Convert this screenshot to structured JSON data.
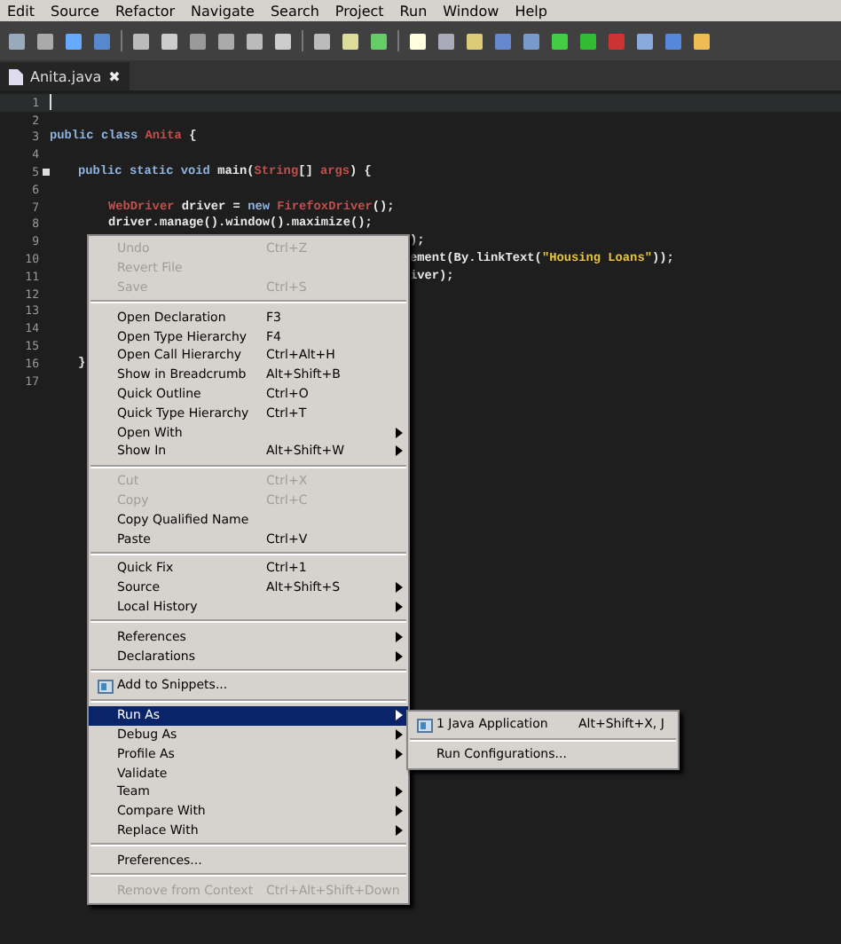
{
  "menubar": [
    "Edit",
    "Source",
    "Refactor",
    "Navigate",
    "Search",
    "Project",
    "Run",
    "Window",
    "Help"
  ],
  "tab": {
    "label": "Anita.java",
    "close": "✖",
    "selected": true
  },
  "editor": {
    "lines": [
      {
        "number": "1",
        "kind": "blank",
        "current": true
      },
      {
        "number": "2",
        "kind": "blank"
      },
      {
        "number": "3",
        "kind": "class",
        "tokens": [
          {
            "kind": "keyword",
            "text": "public class "
          },
          {
            "kind": "type",
            "text": "Anita"
          },
          {
            "kind": "plain",
            "text": " {"
          }
        ]
      },
      {
        "number": "4",
        "kind": "blank"
      },
      {
        "number": "5",
        "fold": true,
        "kind": "method",
        "tokens": [
          {
            "kind": "keyword",
            "text": "public static void "
          },
          {
            "kind": "plain",
            "text": "main("
          },
          {
            "kind": "type",
            "text": "String"
          },
          {
            "kind": "plain",
            "text": "[] "
          },
          {
            "kind": "type",
            "text": "args"
          },
          {
            "kind": "plain",
            "text": ") {"
          }
        ]
      },
      {
        "number": "6",
        "kind": "blank"
      },
      {
        "number": "7",
        "kind": "statement",
        "tokens": [
          {
            "kind": "type",
            "text": "WebDriver"
          },
          {
            "kind": "plain",
            "text": " driver = "
          },
          {
            "kind": "keyword",
            "text": "new "
          },
          {
            "kind": "type",
            "text": "FirefoxDriver"
          },
          {
            "kind": "plain",
            "text": "();"
          }
        ]
      },
      {
        "number": "8",
        "kind": "statement",
        "tokens": [
          {
            "kind": "plain",
            "text": "driver.manage().window().maximize();"
          }
        ]
      },
      {
        "number": "9",
        "kind": "clipped",
        "tokens": [
          {
            "kind": "plain",
            "text": ");"
          }
        ]
      },
      {
        "number": "10",
        "kind": "clipped",
        "tokens": [
          {
            "kind": "plain",
            "text": "ement(By.linkText("
          },
          {
            "kind": "string",
            "text": "\"Housing Loans\""
          },
          {
            "kind": "plain",
            "text": "));"
          }
        ]
      },
      {
        "number": "11",
        "kind": "clipped",
        "tokens": [
          {
            "kind": "plain",
            "text": "iver);"
          }
        ]
      },
      {
        "number": "12",
        "kind": "blank"
      },
      {
        "number": "13",
        "kind": "blank"
      },
      {
        "number": "14",
        "kind": "blank"
      },
      {
        "number": "15",
        "kind": "blank"
      },
      {
        "number": "16",
        "kind": "method",
        "tokens": [
          {
            "kind": "plain",
            "text": "}"
          }
        ]
      },
      {
        "number": "17",
        "kind": "blank"
      }
    ]
  },
  "context_menu": [
    {
      "kind": "item",
      "label": "Undo",
      "shortcut": "Ctrl+Z",
      "disabled": true
    },
    {
      "kind": "item",
      "label": "Revert File",
      "disabled": true
    },
    {
      "kind": "item",
      "label": "Save",
      "shortcut": "Ctrl+S",
      "disabled": true
    },
    {
      "kind": "separator"
    },
    {
      "kind": "item",
      "label": "Open Declaration",
      "shortcut": "F3"
    },
    {
      "kind": "item",
      "label": "Open Type Hierarchy",
      "shortcut": "F4"
    },
    {
      "kind": "item",
      "label": "Open Call Hierarchy",
      "shortcut": "Ctrl+Alt+H"
    },
    {
      "kind": "item",
      "label": "Show in Breadcrumb",
      "shortcut": "Alt+Shift+B"
    },
    {
      "kind": "item",
      "label": "Quick Outline",
      "shortcut": "Ctrl+O"
    },
    {
      "kind": "item",
      "label": "Quick Type Hierarchy",
      "shortcut": "Ctrl+T"
    },
    {
      "kind": "item",
      "label": "Open With",
      "submenu": true
    },
    {
      "kind": "item",
      "label": "Show In",
      "shortcut": "Alt+Shift+W",
      "submenu": true
    },
    {
      "kind": "separator"
    },
    {
      "kind": "item",
      "label": "Cut",
      "shortcut": "Ctrl+X",
      "disabled": true
    },
    {
      "kind": "item",
      "label": "Copy",
      "shortcut": "Ctrl+C",
      "disabled": true
    },
    {
      "kind": "item",
      "label": "Copy Qualified Name"
    },
    {
      "kind": "item",
      "label": "Paste",
      "shortcut": "Ctrl+V"
    },
    {
      "kind": "separator"
    },
    {
      "kind": "item",
      "label": "Quick Fix",
      "shortcut": "Ctrl+1"
    },
    {
      "kind": "item",
      "label": "Source",
      "shortcut": "Alt+Shift+S",
      "submenu": true
    },
    {
      "kind": "item",
      "label": "Local History",
      "submenu": true
    },
    {
      "kind": "separator"
    },
    {
      "kind": "item",
      "label": "References",
      "submenu": true
    },
    {
      "kind": "item",
      "label": "Declarations",
      "submenu": true
    },
    {
      "kind": "separator"
    },
    {
      "kind": "item",
      "label": "Add to Snippets...",
      "icon": true
    },
    {
      "kind": "separator"
    },
    {
      "kind": "item",
      "label": "Run As",
      "submenu": true,
      "selected": true
    },
    {
      "kind": "item",
      "label": "Debug As",
      "submenu": true
    },
    {
      "kind": "item",
      "label": "Profile As",
      "submenu": true
    },
    {
      "kind": "item",
      "label": "Validate"
    },
    {
      "kind": "item",
      "label": "Team",
      "submenu": true
    },
    {
      "kind": "item",
      "label": "Compare With",
      "submenu": true
    },
    {
      "kind": "item",
      "label": "Replace With",
      "submenu": true
    },
    {
      "kind": "separator"
    },
    {
      "kind": "item",
      "label": "Preferences..."
    },
    {
      "kind": "separator"
    },
    {
      "kind": "item",
      "label": "Remove from Context",
      "shortcut": "Ctrl+Alt+Shift+Down",
      "disabled": true
    }
  ],
  "submenu": [
    {
      "kind": "item",
      "label": "1 Java Application",
      "shortcut": "Alt+Shift+X, J",
      "icon": true
    },
    {
      "kind": "separator"
    },
    {
      "kind": "item",
      "label": "Run Configurations..."
    }
  ]
}
